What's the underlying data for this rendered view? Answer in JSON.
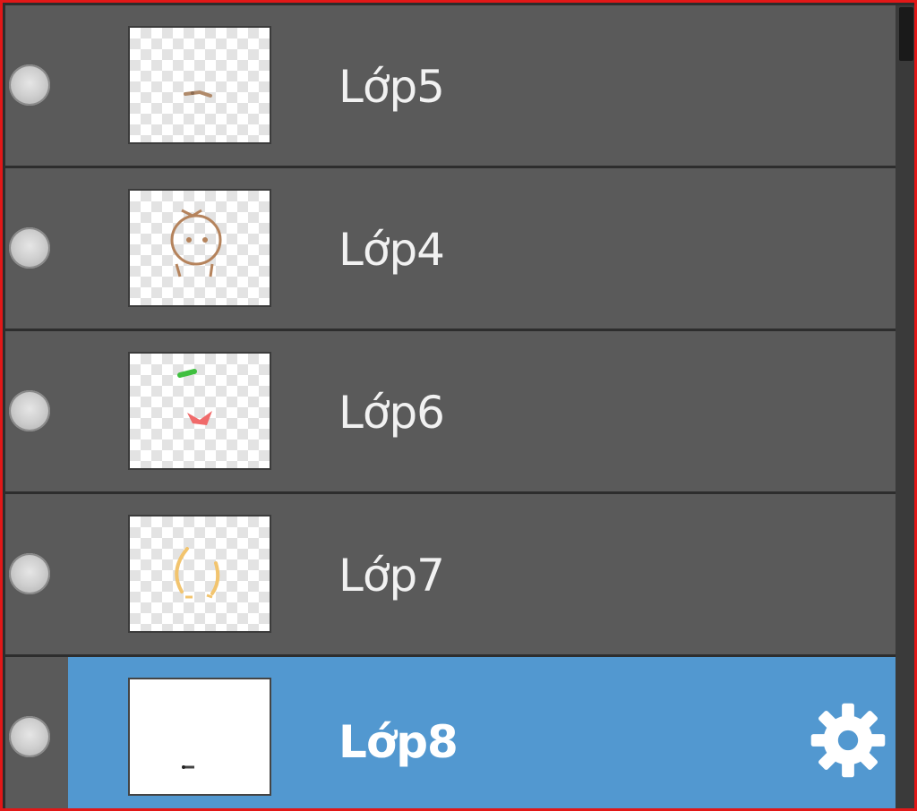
{
  "layers": [
    {
      "name": "Lớp5",
      "selected": false,
      "thumb": "transparent"
    },
    {
      "name": "Lớp4",
      "selected": false,
      "thumb": "transparent"
    },
    {
      "name": "Lớp6",
      "selected": false,
      "thumb": "transparent"
    },
    {
      "name": "Lớp7",
      "selected": false,
      "thumb": "transparent"
    },
    {
      "name": "Lớp8",
      "selected": true,
      "thumb": "white"
    }
  ],
  "icons": {
    "visibility": "visibility-dot-icon",
    "settings": "gear-icon"
  },
  "colors": {
    "row_background": "#5a5a5a",
    "selected_background": "#5298d0",
    "text": "#f1f1f1",
    "frame_border": "#e21818"
  }
}
